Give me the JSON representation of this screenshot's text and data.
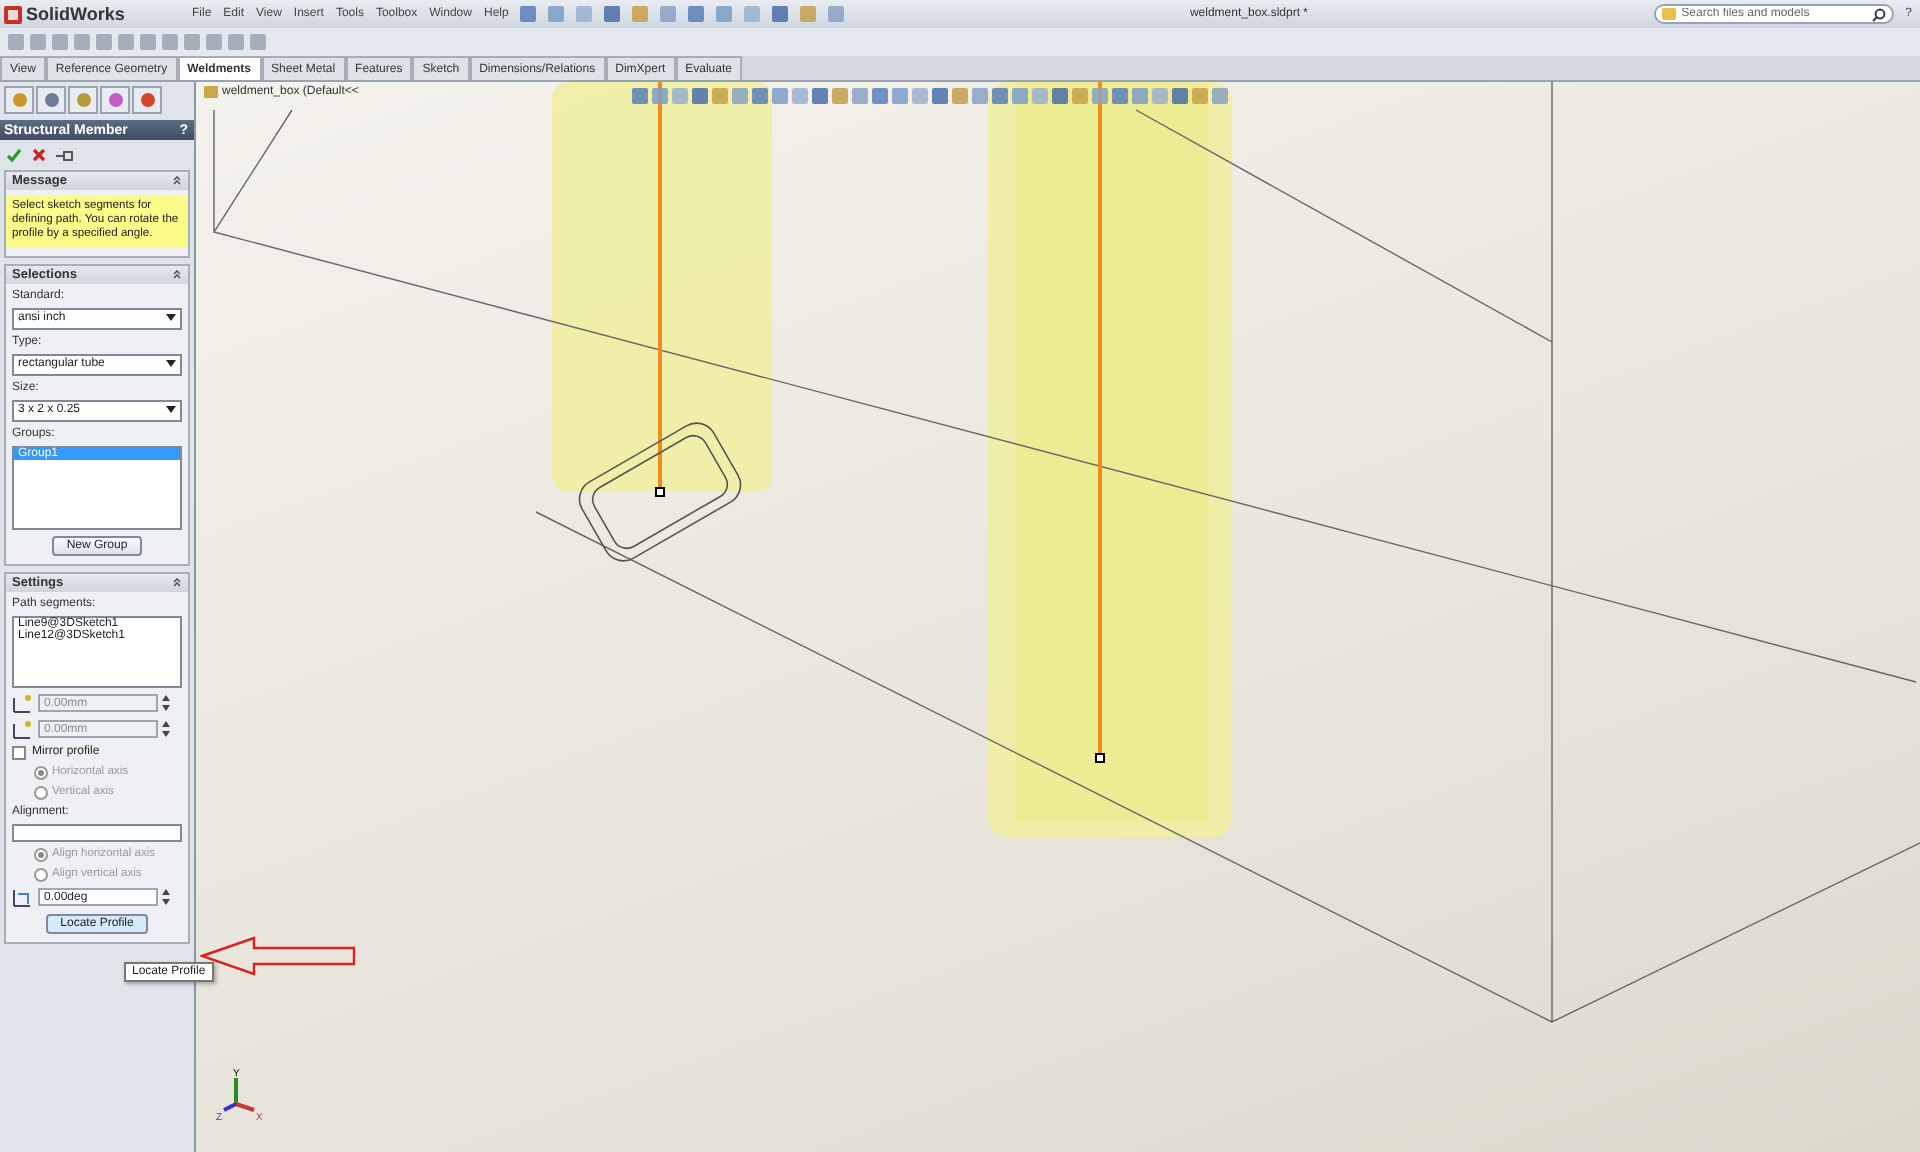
{
  "app": {
    "logo": "SolidWorks",
    "menus": [
      "File",
      "Edit",
      "View",
      "Insert",
      "Tools",
      "Toolbox",
      "Window",
      "Help"
    ],
    "document_title": "weldment_box.sldprt *",
    "search": {
      "placeholder": "Search files and models"
    },
    "help": "?"
  },
  "tabs": [
    {
      "label": "View",
      "selected": false
    },
    {
      "label": "Reference Geometry",
      "selected": false
    },
    {
      "label": "Weldments",
      "selected": true
    },
    {
      "label": "Sheet Metal",
      "selected": false
    },
    {
      "label": "Features",
      "selected": false
    },
    {
      "label": "Sketch",
      "selected": false
    },
    {
      "label": "Dimensions/Relations",
      "selected": false
    },
    {
      "label": "DimXpert",
      "selected": false
    },
    {
      "label": "Evaluate",
      "selected": false
    }
  ],
  "feature_tree": {
    "label": "weldment_box (Default<<"
  },
  "panel": {
    "title": "Structural Member",
    "help": "?",
    "message": {
      "title": "Message",
      "text": "Select sketch segments for defining path. You can rotate the profile by a specified angle."
    },
    "selections": {
      "title": "Selections",
      "fields": [
        {
          "label": "Standard:",
          "value": "ansi inch"
        },
        {
          "label": "Type:",
          "value": "rectangular tube"
        },
        {
          "label": "Size:",
          "value": "3 x 2 x 0.25"
        }
      ],
      "groups_label": "Groups:",
      "groups": [
        {
          "label": "Group1",
          "selected": true
        }
      ],
      "button": "New Group"
    },
    "settings": {
      "title": "Settings",
      "segments_label": "Path segments:",
      "segments": [
        "Line9@3DSketch1",
        "Line12@3DSketch1"
      ],
      "offsets": [
        "0.00mm",
        "0.00mm"
      ],
      "mirror": {
        "label": "Mirror profile",
        "checked": false
      },
      "mirror_axes": [
        {
          "label": "Horizontal axis",
          "selected": true,
          "disabled": true
        },
        {
          "label": "Vertical axis",
          "selected": false,
          "disabled": true
        }
      ],
      "alignment_label": "Alignment:",
      "align_axes": [
        {
          "label": "Align horizontal axis",
          "selected": true,
          "disabled": true
        },
        {
          "label": "Align vertical axis",
          "selected": false,
          "disabled": true
        }
      ],
      "angle": "0.00deg",
      "button": "Locate Profile",
      "tooltip": "Locate Profile"
    }
  },
  "triad": {
    "labels": [
      "Y",
      "Z",
      "X"
    ]
  }
}
